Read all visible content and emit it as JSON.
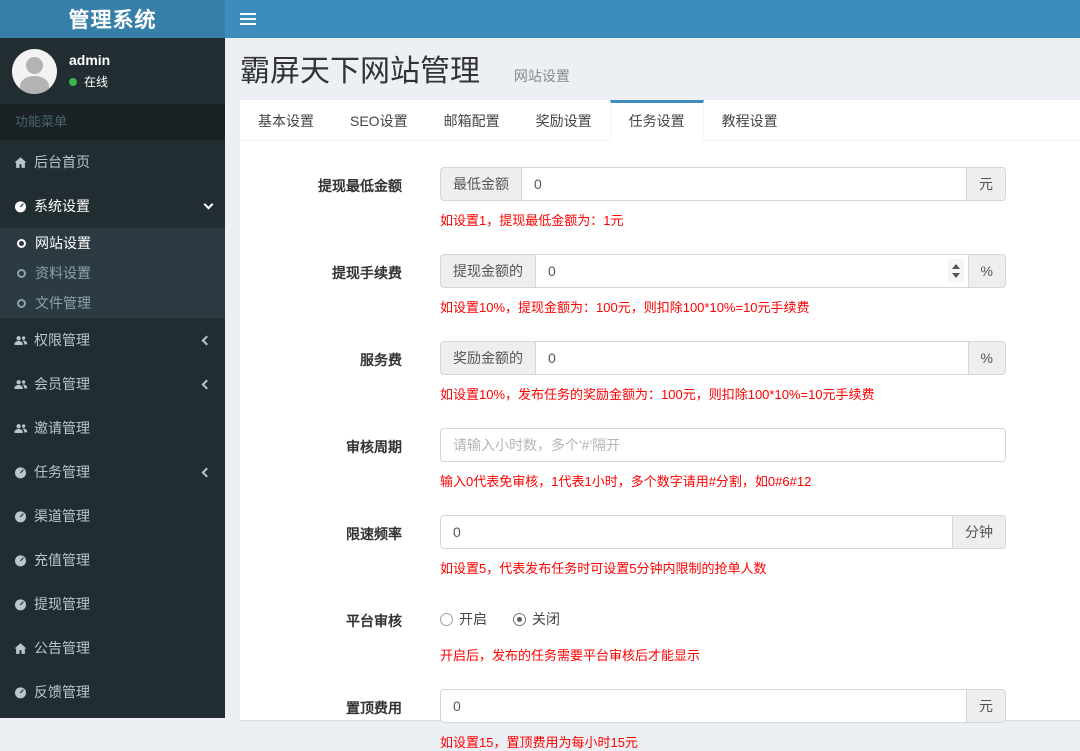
{
  "app": {
    "title": "管理系统"
  },
  "colors": {
    "navbar": "#3c8dbc",
    "logo_bg": "#367fa9",
    "sidebar_bg": "#222d32",
    "submenu_bg": "#2c3b41",
    "tab_accent": "#3c8dbc",
    "hint_red": "#ff0000",
    "online_green": "#39b54a"
  },
  "sidebar": {
    "user": {
      "name": "admin",
      "status": "在线"
    },
    "section_header": "功能菜单",
    "items": [
      {
        "label": "后台首页",
        "icon": "home-icon"
      },
      {
        "label": "系统设置",
        "icon": "gauge-icon",
        "chevron": "down",
        "active": true,
        "children": [
          {
            "label": "网站设置",
            "active": true
          },
          {
            "label": "资料设置",
            "active": false
          },
          {
            "label": "文件管理",
            "active": false
          }
        ]
      },
      {
        "label": "权限管理",
        "icon": "users-icon",
        "chevron": "left"
      },
      {
        "label": "会员管理",
        "icon": "users-icon",
        "chevron": "left"
      },
      {
        "label": "邀请管理",
        "icon": "users-icon"
      },
      {
        "label": "任务管理",
        "icon": "gauge-icon",
        "chevron": "left"
      },
      {
        "label": "渠道管理",
        "icon": "gauge-icon"
      },
      {
        "label": "充值管理",
        "icon": "gauge-icon"
      },
      {
        "label": "提现管理",
        "icon": "gauge-icon"
      },
      {
        "label": "公告管理",
        "icon": "home-icon"
      },
      {
        "label": "反馈管理",
        "icon": "gauge-icon"
      }
    ]
  },
  "page": {
    "title": "霸屏天下网站管理",
    "subtitle": "网站设置"
  },
  "tabs": [
    {
      "label": "基本设置",
      "active": false
    },
    {
      "label": "SEO设置",
      "active": false
    },
    {
      "label": "邮箱配置",
      "active": false
    },
    {
      "label": "奖励设置",
      "active": false
    },
    {
      "label": "任务设置",
      "active": true
    },
    {
      "label": "教程设置",
      "active": false
    }
  ],
  "form": {
    "rows": [
      {
        "label": "提现最低金额",
        "type": "input-group",
        "prefix": "最低金额",
        "value": "0",
        "suffix": "元",
        "hint": "如设置1，提现最低金额为：1元"
      },
      {
        "label": "提现手续费",
        "type": "input-group",
        "prefix": "提现金额的",
        "value": "0",
        "suffix": "%",
        "spinner": true,
        "hint": "如设置10%，提现金额为：100元，则扣除100*10%=10元手续费"
      },
      {
        "label": "服务费",
        "type": "input-group",
        "prefix": "奖励金额的",
        "value": "0",
        "suffix": "%",
        "hint": "如设置10%，发布任务的奖励金额为：100元，则扣除100*10%=10元手续费"
      },
      {
        "label": "审核周期",
        "type": "input",
        "placeholder": "请输入小时数，多个'#'隔开",
        "hint": "输入0代表免审核，1代表1小时，多个数字请用#分割，如0#6#12"
      },
      {
        "label": "限速频率",
        "type": "input-group",
        "value": "0",
        "suffix": "分钟",
        "hint": "如设置5，代表发布任务时可设置5分钟内限制的抢单人数"
      },
      {
        "label": "平台审核",
        "type": "radio",
        "options": [
          {
            "label": "开启",
            "checked": false
          },
          {
            "label": "关闭",
            "checked": true
          }
        ],
        "hint": "开启后，发布的任务需要平台审核后才能显示"
      },
      {
        "label": "置顶费用",
        "type": "input-group",
        "value": "0",
        "suffix": "元",
        "hint": "如设置15，置顶费用为每小时15元"
      }
    ]
  }
}
